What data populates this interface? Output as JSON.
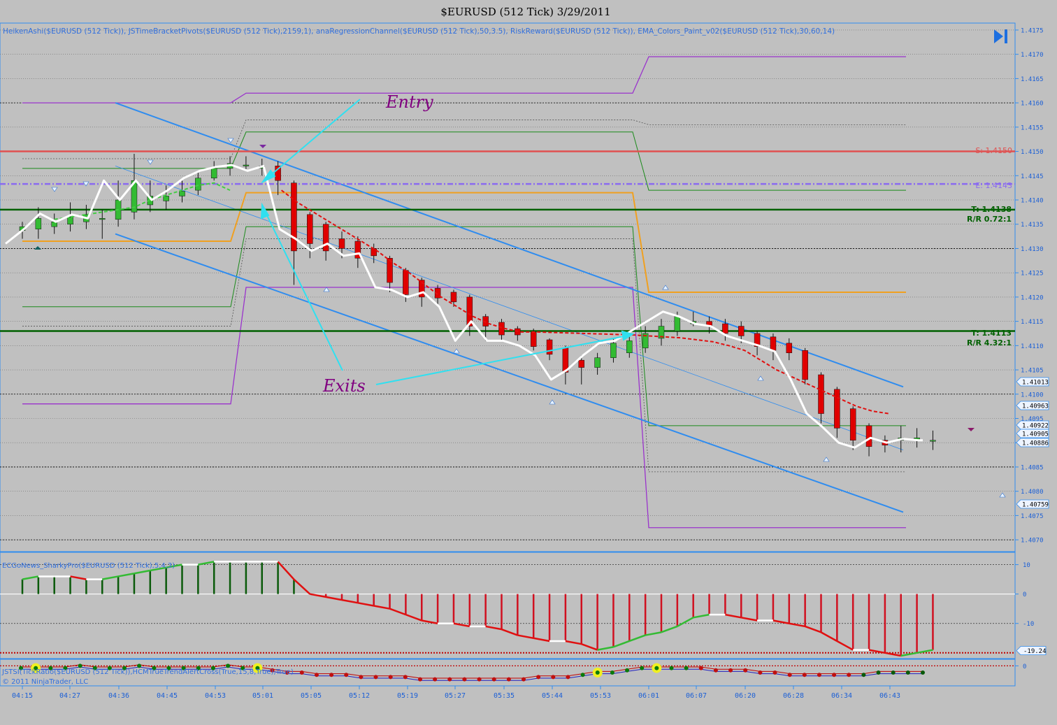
{
  "window": {
    "title": "$EURUSD (512 Tick)  3/29/2011",
    "indicators_header": "HeikenAshi($EURUSD (512 Tick)), JSTimeBracketPivots($EURUSD (512 Tick),2159,1), anaRegressionChannel($EURUSD (512 Tick),50,3.5), RiskReward($EURUSD (512 Tick)), EMA_Colors_Paint_v02($EURUSD (512 Tick),30,60,14)",
    "panel2_label": "ECGoNews_SharkyPro($EURUSD (512 Tick),5,4,3)",
    "panel3_label": "JSTSI(TickRatio($EURUSD (512 Tick)),HCMTrueTrendAlertCross(True,15,8,True),True)",
    "copyright": "© 2011 NinjaTrader, LLC"
  },
  "colors": {
    "background": "#c0c0c0",
    "bull": "#33bb33",
    "bear": "#e00000",
    "price_line": "#ffffff",
    "regression": "#2f8cef",
    "stop": "#e05050",
    "entry": "#8a6af0",
    "target": "#006000",
    "orange": "#f0a020",
    "purple": "#9a33cc",
    "annotation": "#800080",
    "arrow": "#30e0f0",
    "axis_text": "#1b5fd6"
  },
  "annotations": {
    "entry": "Entry",
    "exits": "Exits"
  },
  "levels": {
    "stop_label": "S: 1.4150",
    "entry_label": "E: 1.4143",
    "target1_label": "T: 1.4138",
    "rr1_label": "R/R 0.72:1",
    "target2_label": "T: 1.4113",
    "rr2_label": "R/R 4.32:1"
  },
  "price_tags": [
    "1.41013",
    "1.40963",
    "1.40922",
    "1.40905",
    "1.40886",
    "1.40759"
  ],
  "panel2_tags": {
    "current": "-19.24"
  },
  "chart_data": [
    {
      "type": "candlestick",
      "title": "$EURUSD (512 Tick)  3/29/2011",
      "x_ticks": [
        "04:15",
        "04:27",
        "04:36",
        "04:45",
        "04:53",
        "05:01",
        "05:05",
        "05:12",
        "05:19",
        "05:27",
        "05:35",
        "05:44",
        "05:53",
        "06:01",
        "06:07",
        "06:20",
        "06:28",
        "06:34",
        "06:43"
      ],
      "y_ticks": [
        "1.4175",
        "1.4170",
        "1.4165",
        "1.4160",
        "1.4155",
        "1.4150",
        "1.4145",
        "1.4140",
        "1.4135",
        "1.4130",
        "1.4125",
        "1.4120",
        "1.4115",
        "1.4110",
        "1.4105",
        "1.4100",
        "1.4095",
        "1.4090",
        "1.4085",
        "1.4080",
        "1.4075",
        "1.4070"
      ],
      "ylim": [
        1.4068,
        1.4176
      ],
      "candles": [
        {
          "o": 1.41337,
          "c": 1.41345,
          "h": 1.41355,
          "l": 1.4132
        },
        {
          "o": 1.4134,
          "c": 1.41362,
          "h": 1.41385,
          "l": 1.4132
        },
        {
          "o": 1.41345,
          "c": 1.41355,
          "h": 1.41372,
          "l": 1.4133
        },
        {
          "o": 1.4135,
          "c": 1.41365,
          "h": 1.41395,
          "l": 1.41335
        },
        {
          "o": 1.41355,
          "c": 1.4137,
          "h": 1.4139,
          "l": 1.4134
        },
        {
          "o": 1.4136,
          "c": 1.41362,
          "h": 1.4138,
          "l": 1.4132
        },
        {
          "o": 1.4136,
          "c": 1.414,
          "h": 1.4144,
          "l": 1.41345
        },
        {
          "o": 1.41375,
          "c": 1.4144,
          "h": 1.41495,
          "l": 1.4136
        },
        {
          "o": 1.4139,
          "c": 1.41408,
          "h": 1.4144,
          "l": 1.41375
        },
        {
          "o": 1.41398,
          "c": 1.41408,
          "h": 1.4143,
          "l": 1.4138
        },
        {
          "o": 1.41408,
          "c": 1.41418,
          "h": 1.4144,
          "l": 1.41395
        },
        {
          "o": 1.4142,
          "c": 1.41445,
          "h": 1.4146,
          "l": 1.4141
        },
        {
          "o": 1.41445,
          "c": 1.41465,
          "h": 1.4148,
          "l": 1.4144
        },
        {
          "o": 1.41465,
          "c": 1.41475,
          "h": 1.4149,
          "l": 1.4145
        },
        {
          "o": 1.4147,
          "c": 1.41472,
          "h": 1.4149,
          "l": 1.4146
        },
        {
          "o": 1.41465,
          "c": 1.4147,
          "h": 1.41485,
          "l": 1.4145
        },
        {
          "o": 1.4147,
          "c": 1.4144,
          "h": 1.4148,
          "l": 1.4141
        },
        {
          "o": 1.41435,
          "c": 1.41295,
          "h": 1.4144,
          "l": 1.41225
        },
        {
          "o": 1.4137,
          "c": 1.4131,
          "h": 1.41375,
          "l": 1.4128
        },
        {
          "o": 1.4135,
          "c": 1.41295,
          "h": 1.41355,
          "l": 1.41275
        },
        {
          "o": 1.4132,
          "c": 1.413,
          "h": 1.41335,
          "l": 1.4128
        },
        {
          "o": 1.41315,
          "c": 1.4128,
          "h": 1.41325,
          "l": 1.4126
        },
        {
          "o": 1.413,
          "c": 1.41285,
          "h": 1.4131,
          "l": 1.4127
        },
        {
          "o": 1.4128,
          "c": 1.4123,
          "h": 1.41285,
          "l": 1.4121
        },
        {
          "o": 1.41255,
          "c": 1.41205,
          "h": 1.4126,
          "l": 1.4119
        },
        {
          "o": 1.41235,
          "c": 1.412,
          "h": 1.4124,
          "l": 1.4118
        },
        {
          "o": 1.41218,
          "c": 1.41198,
          "h": 1.41225,
          "l": 1.41185
        },
        {
          "o": 1.4121,
          "c": 1.4119,
          "h": 1.41215,
          "l": 1.4118
        },
        {
          "o": 1.412,
          "c": 1.4114,
          "h": 1.41205,
          "l": 1.4112
        },
        {
          "o": 1.4116,
          "c": 1.4114,
          "h": 1.41165,
          "l": 1.4111
        },
        {
          "o": 1.41148,
          "c": 1.41122,
          "h": 1.41155,
          "l": 1.4111
        },
        {
          "o": 1.41135,
          "c": 1.41122,
          "h": 1.4114,
          "l": 1.4111
        },
        {
          "o": 1.41128,
          "c": 1.41098,
          "h": 1.41135,
          "l": 1.4109
        },
        {
          "o": 1.41112,
          "c": 1.41082,
          "h": 1.41115,
          "l": 1.4107
        },
        {
          "o": 1.41095,
          "c": 1.41045,
          "h": 1.411,
          "l": 1.4102
        },
        {
          "o": 1.4107,
          "c": 1.41055,
          "h": 1.4108,
          "l": 1.4102
        },
        {
          "o": 1.41055,
          "c": 1.41075,
          "h": 1.41085,
          "l": 1.4104
        },
        {
          "o": 1.41075,
          "c": 1.41105,
          "h": 1.41115,
          "l": 1.41065
        },
        {
          "o": 1.41085,
          "c": 1.4111,
          "h": 1.41125,
          "l": 1.41075
        },
        {
          "o": 1.41095,
          "c": 1.41125,
          "h": 1.4114,
          "l": 1.41085
        },
        {
          "o": 1.41115,
          "c": 1.4114,
          "h": 1.41155,
          "l": 1.411
        },
        {
          "o": 1.4113,
          "c": 1.4116,
          "h": 1.4117,
          "l": 1.4112
        },
        {
          "o": 1.41145,
          "c": 1.4115,
          "h": 1.4117,
          "l": 1.4114
        },
        {
          "o": 1.4115,
          "c": 1.4114,
          "h": 1.4116,
          "l": 1.41125
        },
        {
          "o": 1.41145,
          "c": 1.41125,
          "h": 1.41155,
          "l": 1.4111
        },
        {
          "o": 1.4114,
          "c": 1.4112,
          "h": 1.4115,
          "l": 1.41105
        },
        {
          "o": 1.41125,
          "c": 1.41098,
          "h": 1.4113,
          "l": 1.4108
        },
        {
          "o": 1.41118,
          "c": 1.4109,
          "h": 1.41125,
          "l": 1.4107
        },
        {
          "o": 1.41105,
          "c": 1.41085,
          "h": 1.41115,
          "l": 1.4107
        },
        {
          "o": 1.4109,
          "c": 1.4103,
          "h": 1.41095,
          "l": 1.4102
        },
        {
          "o": 1.4104,
          "c": 1.4096,
          "h": 1.41045,
          "l": 1.4094
        },
        {
          "o": 1.4101,
          "c": 1.4093,
          "h": 1.41015,
          "l": 1.4091
        },
        {
          "o": 1.4097,
          "c": 1.40905,
          "h": 1.40975,
          "l": 1.40885
        },
        {
          "o": 1.40935,
          "c": 1.40892,
          "h": 1.4094,
          "l": 1.40872
        },
        {
          "o": 1.40905,
          "c": 1.40895,
          "h": 1.40915,
          "l": 1.4088
        },
        {
          "o": 1.40905,
          "c": 1.4091,
          "h": 1.40935,
          "l": 1.4088
        },
        {
          "o": 1.40905,
          "c": 1.4091,
          "h": 1.4093,
          "l": 1.4089
        },
        {
          "o": 1.40905,
          "c": 1.40905,
          "h": 1.40925,
          "l": 1.40885
        }
      ],
      "price_line": [
        1.4131,
        1.4134,
        1.41372,
        1.41355,
        1.4137,
        1.41362,
        1.4144,
        1.414,
        1.4144,
        1.414,
        1.4142,
        1.41445,
        1.4146,
        1.41468,
        1.41472,
        1.4146,
        1.4147,
        1.4134,
        1.4132,
        1.41295,
        1.4131,
        1.41285,
        1.4129,
        1.4122,
        1.41215,
        1.412,
        1.4121,
        1.4118,
        1.4111,
        1.4115,
        1.4111,
        1.4111,
        1.411,
        1.4108,
        1.4103,
        1.4105,
        1.4108,
        1.41105,
        1.4111,
        1.4113,
        1.4115,
        1.4117,
        1.4116,
        1.41145,
        1.4114,
        1.4112,
        1.4111,
        1.411,
        1.41088,
        1.4103,
        1.4096,
        1.40932,
        1.409,
        1.4089,
        1.4091,
        1.409,
        1.40908,
        1.40905
      ],
      "ema": [
        1.4136,
        1.41365,
        1.4137,
        1.41375,
        1.4138,
        1.41385,
        1.414,
        1.4141,
        1.4142,
        1.4143,
        1.41435,
        1.4142,
        1.414,
        1.4138,
        1.41355,
        1.41335,
        1.4131,
        1.4129,
        1.4127,
        1.4125,
        1.4123,
        1.41205,
        1.41185,
        1.4117,
        1.4115,
        1.41145,
        1.4114,
        1.41135,
        1.4113,
        1.4111,
        1.4109,
        1.4104,
        1.41,
        1.4098,
        1.4096
      ],
      "regression_center": [
        [
          1.415,
          0
        ],
        [
          1.409,
          57
        ]
      ],
      "regression_upper": [
        [
          1.416,
          6
        ],
        [
          1.41015,
          57
        ]
      ],
      "regression_lower": [
        [
          1.4133,
          6
        ],
        [
          1.4076,
          57
        ]
      ],
      "levels": {
        "stop": 1.415,
        "entry": 1.41433,
        "target1": 1.4138,
        "target2": 1.4113
      }
    },
    {
      "type": "bar",
      "name": "ECGoNews_SharkyPro",
      "y_ticks": [
        "10",
        "0",
        "-10"
      ],
      "ylim": [
        -21,
        13
      ],
      "values": [
        5,
        6,
        6,
        6,
        5,
        5,
        6,
        7,
        8,
        9,
        10,
        10,
        11,
        11,
        11,
        11,
        11,
        5,
        0,
        -1,
        -2,
        -3,
        -4,
        -5,
        -7,
        -9,
        -10,
        -10,
        -11,
        -11,
        -12,
        -14,
        -15,
        -16,
        -16,
        -17,
        -19,
        -18,
        -16,
        -14,
        -13,
        -11,
        -8,
        -7,
        -7,
        -8,
        -9,
        -9,
        -10,
        -11,
        -13,
        -16,
        -19,
        -19,
        -20,
        -21,
        -20,
        -19
      ],
      "current": -19.24
    },
    {
      "type": "line",
      "name": "JSTSI",
      "y_ticks": [
        "0"
      ],
      "ylim": [
        -8,
        2
      ],
      "dots": [
        -1,
        -1,
        -1,
        -1,
        0,
        -1,
        -1,
        -1,
        0,
        -1,
        -1,
        -1,
        -1,
        -1,
        0,
        -1,
        -1,
        -2,
        -3,
        -3,
        -4,
        -4,
        -4,
        -5,
        -5,
        -5,
        -5,
        -6,
        -6,
        -6,
        -6,
        -6,
        -6,
        -6,
        -6,
        -5,
        -5,
        -5,
        -4,
        -3,
        -3,
        -2,
        -1,
        -1,
        -1,
        -1,
        -1,
        -2,
        -2,
        -2,
        -3,
        -3,
        -4,
        -4,
        -4,
        -4,
        -4,
        -4,
        -3,
        -3,
        -3,
        -3
      ],
      "highlights": [
        1,
        16,
        39,
        43
      ]
    }
  ]
}
